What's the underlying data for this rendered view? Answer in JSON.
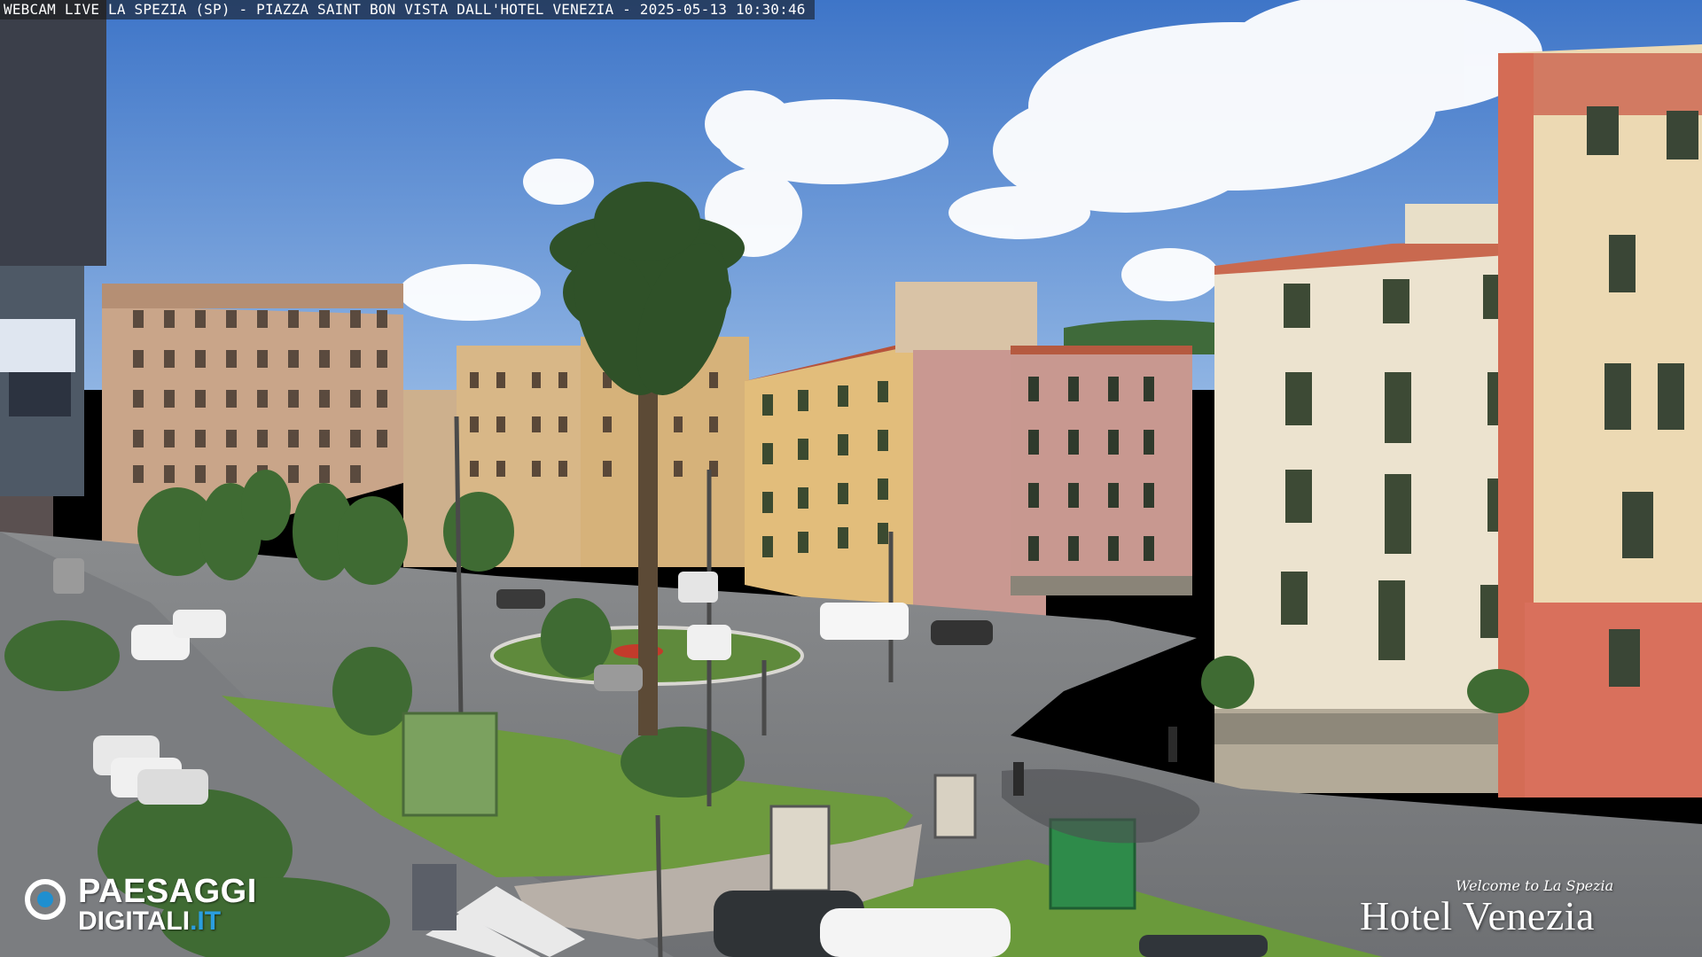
{
  "overlay": {
    "caption": "WEBCAM LIVE LA SPEZIA (SP) - PIAZZA SAINT BON VISTA DALL'HOTEL VENEZIA - 2025-05-13 10:30:46"
  },
  "logos": {
    "left_line1": "PAESAGGI",
    "left_line2_main": "DIGITALI",
    "left_line2_tld": ".IT",
    "right_welcome": "Welcome to La Spezia",
    "right_name": "Hotel Venezia"
  },
  "colors": {
    "sky": "#5b8fd6",
    "road": "#7d7f82",
    "grass": "#6d9a3e",
    "logo_accent": "#1f8fd0"
  },
  "icons": {
    "left_logo_mark": "camera-lens-icon"
  }
}
